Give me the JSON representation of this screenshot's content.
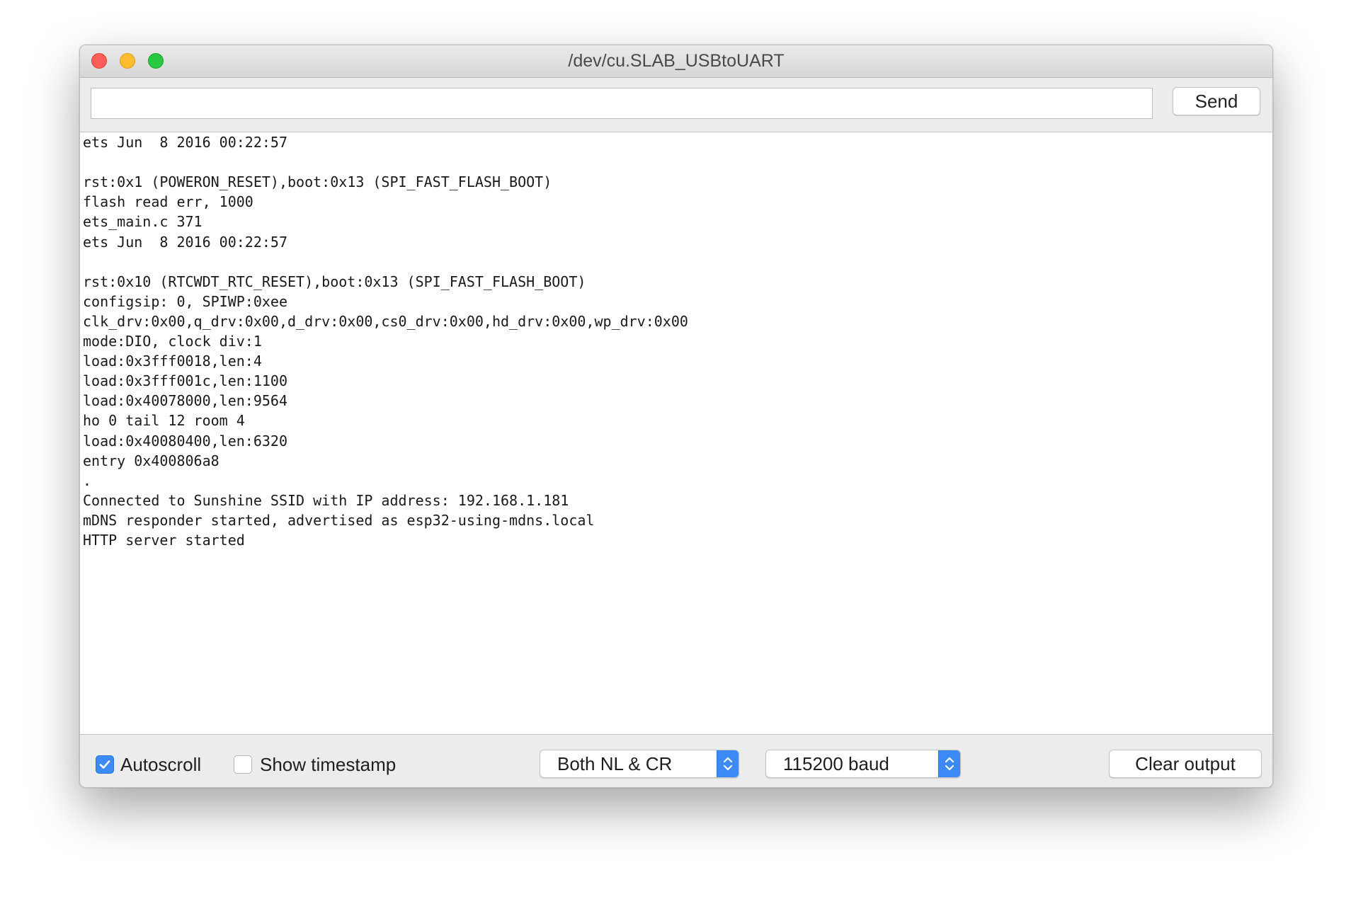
{
  "window": {
    "title": "/dev/cu.SLAB_USBtoUART"
  },
  "toolbar": {
    "input_value": "",
    "send_label": "Send"
  },
  "output": {
    "lines": [
      "ets Jun  8 2016 00:22:57",
      "",
      "rst:0x1 (POWERON_RESET),boot:0x13 (SPI_FAST_FLASH_BOOT)",
      "flash read err, 1000",
      "ets_main.c 371",
      "ets Jun  8 2016 00:22:57",
      "",
      "rst:0x10 (RTCWDT_RTC_RESET),boot:0x13 (SPI_FAST_FLASH_BOOT)",
      "configsip: 0, SPIWP:0xee",
      "clk_drv:0x00,q_drv:0x00,d_drv:0x00,cs0_drv:0x00,hd_drv:0x00,wp_drv:0x00",
      "mode:DIO, clock div:1",
      "load:0x3fff0018,len:4",
      "load:0x3fff001c,len:1100",
      "load:0x40078000,len:9564",
      "ho 0 tail 12 room 4",
      "load:0x40080400,len:6320",
      "entry 0x400806a8",
      ".",
      "Connected to Sunshine SSID with IP address: 192.168.1.181",
      "mDNS responder started, advertised as esp32-using-mdns.local",
      "HTTP server started"
    ]
  },
  "footer": {
    "autoscroll_label": "Autoscroll",
    "autoscroll_checked": true,
    "timestamp_label": "Show timestamp",
    "timestamp_checked": false,
    "line_ending_value": "Both NL & CR",
    "baud_value": "115200 baud",
    "clear_label": "Clear output"
  },
  "colors": {
    "accent": "#3b8af6",
    "close": "#fc5f57",
    "minimize": "#fdbc2e",
    "zoom": "#28c840"
  },
  "icons": {
    "autoscroll": "checkmark-icon",
    "select_arrows": "up-down-chevron-icon"
  }
}
